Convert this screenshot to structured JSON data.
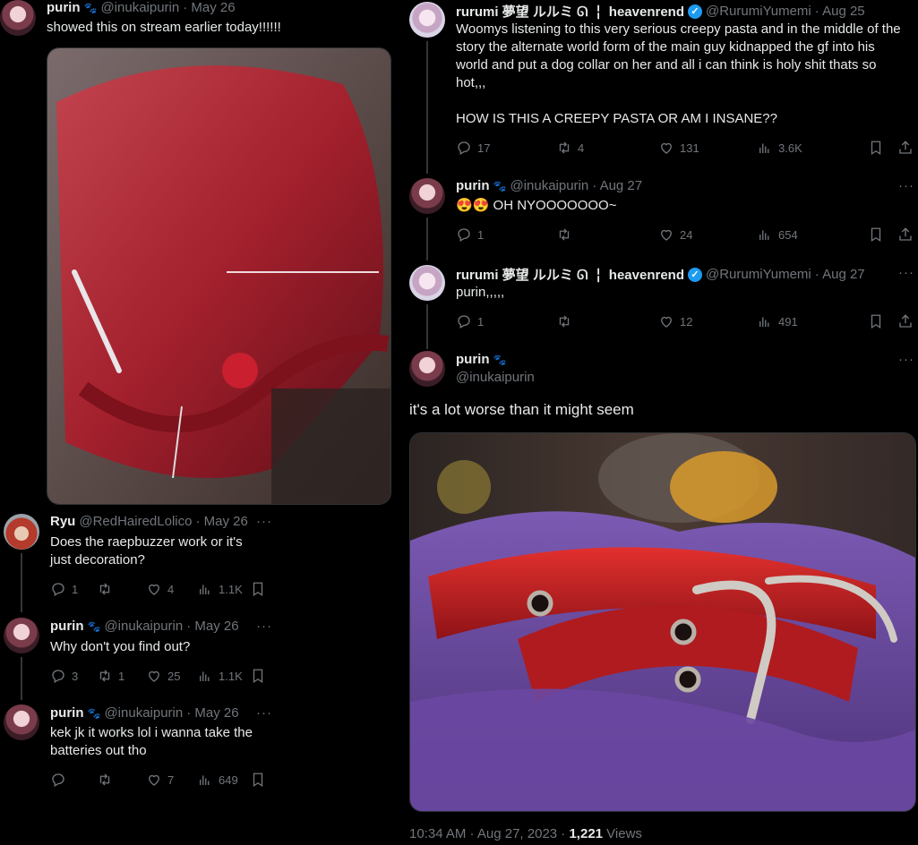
{
  "left_top": {
    "name": "purin",
    "handle": "@inukaipurin",
    "date": "· May 26",
    "text": "showed this on stream earlier today!!!!!!"
  },
  "left_replies": [
    {
      "name": "Ryu",
      "handle": "@RedHairedLolico",
      "date": "· May 26",
      "text": "Does the raepbuzzer work or it's\njust decoration?",
      "reply": "1",
      "retweet": "",
      "like": "4",
      "views": "1.1K"
    },
    {
      "name": "purin",
      "handle": "@inukaipurin",
      "date": "· May 26",
      "text": "Why don't you find out?",
      "reply": "3",
      "retweet": "1",
      "like": "25",
      "views": "1.1K"
    },
    {
      "name": "purin",
      "handle": "@inukaipurin",
      "date": "· May 26",
      "text": "kek jk it works lol i wanna take the\nbatteries out tho",
      "reply": "",
      "retweet": "",
      "like": "7",
      "views": "649"
    }
  ],
  "right_thread": [
    {
      "name": "rurumi 夢望 ルルミ ᘏ ╎ heavenrend",
      "handle": "@RurumiYumemi",
      "date": "· Aug 25",
      "text": "Woomys listening to this very serious creepy pasta and in the middle of the\nstory the alternate world form of the main guy kidnapped the gf into his\nworld and put a dog collar on her and all i can think is holy shit thats so\nhot,,,\n\nHOW IS THIS A CREEPY PASTA OR AM I INSANE??",
      "reply": "17",
      "retweet": "4",
      "like": "131",
      "views": "3.6K"
    },
    {
      "name": "purin",
      "handle": "@inukaipurin",
      "date": "· Aug 27",
      "text": "😍😍 OH NYOOOOOOO~",
      "reply": "1",
      "retweet": "",
      "like": "24",
      "views": "654"
    },
    {
      "name": "rurumi 夢望 ルルミ ᘏ ╎ heavenrend",
      "handle": "@RurumiYumemi",
      "date": "· Aug 27",
      "text": "purin,,,,,",
      "reply": "1",
      "retweet": "",
      "like": "12",
      "views": "491"
    }
  ],
  "main_tweet": {
    "name": "purin",
    "handle": "@inukaipurin",
    "text": "it's a lot worse than it might seem",
    "timestamp": "10:34 AM · Aug 27, 2023 · ",
    "views_count": "1,221",
    "views_label": " Views"
  },
  "icons": {
    "paw": "paw-icon",
    "verified": "verified-badge-icon",
    "more": "more-icon"
  },
  "colors": {
    "verified": "#1d9bf0",
    "secondary_text": "#71767b",
    "divider": "#2f3336"
  }
}
